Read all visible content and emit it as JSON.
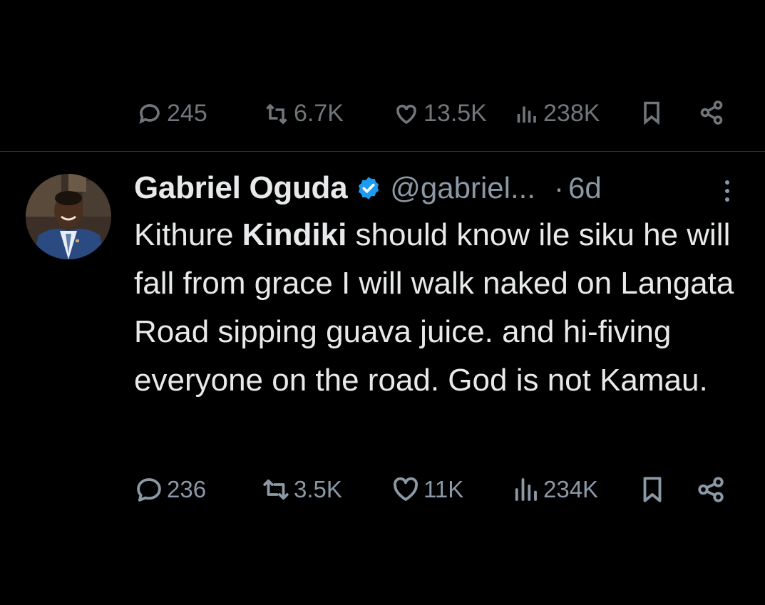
{
  "tweet": {
    "author": {
      "display_name": "Gabriel Oguda",
      "handle": "@gabriel...",
      "verified": true
    },
    "separator": "·",
    "time": "6d",
    "text_segments": [
      {
        "text": "Kithure ",
        "bold": false
      },
      {
        "text": "Kindiki",
        "bold": true
      },
      {
        "text": " should know ile siku he will fall from grace I will walk naked on Langata Road sipping guava juice. and hi-fiving everyone on the road. God is not Kamau.",
        "bold": false
      }
    ],
    "actions": {
      "replies": "236",
      "reposts": "3.5K",
      "likes": "11K",
      "views": "234K"
    }
  },
  "previous_tweet_actions": {
    "replies": "245",
    "reposts": "6.7K",
    "likes": "13.5K",
    "views": "238K"
  },
  "icons": {
    "reply": "reply-icon",
    "repost": "repost-icon",
    "like": "heart-icon",
    "views": "views-icon",
    "bookmark": "bookmark-icon",
    "share": "share-icon",
    "more": "more-icon",
    "verified": "verified-badge-icon"
  },
  "colors": {
    "background": "#000000",
    "text": "#e7e9ea",
    "secondary": "#8b98a5",
    "verified": "#1d9bf0",
    "divider": "#2f3336"
  }
}
